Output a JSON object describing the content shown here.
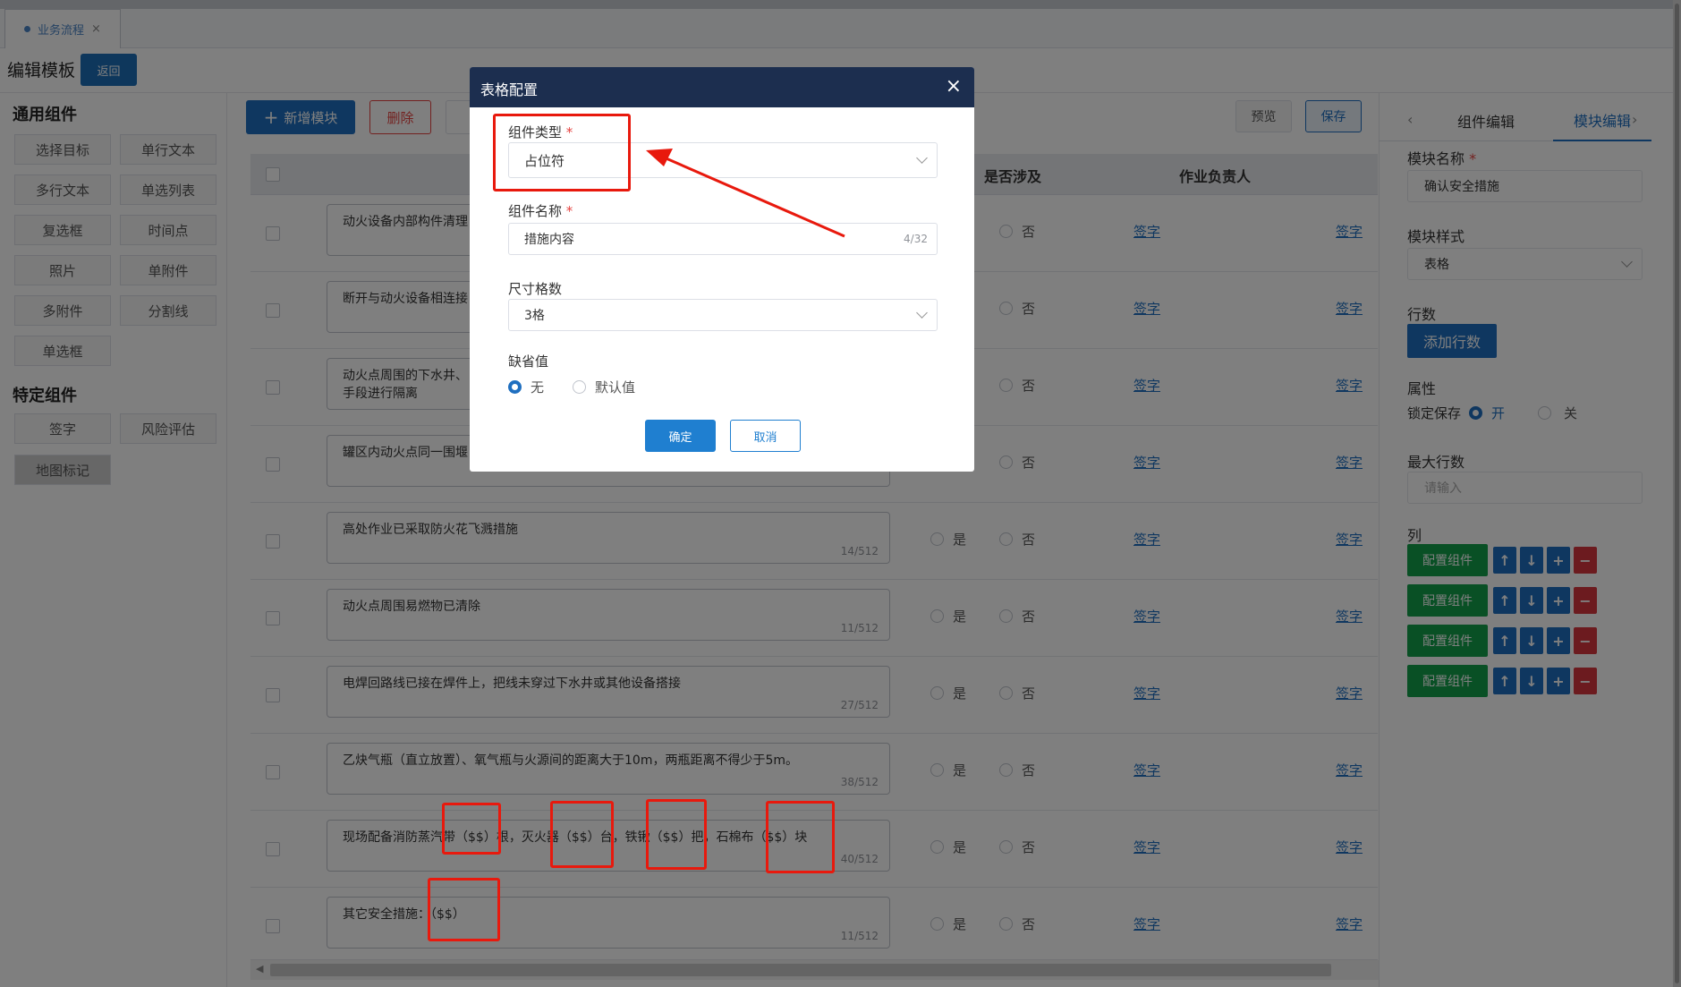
{
  "tabbar": {
    "tab_label": "业务流程",
    "tab_close": "×"
  },
  "header": {
    "title": "编辑模板",
    "back": "返回"
  },
  "left": {
    "general_title": "通用组件",
    "general": [
      "选择目标",
      "单行文本",
      "多行文本",
      "单选列表",
      "复选框",
      "时间点",
      "照片",
      "单附件",
      "多附件",
      "分割线",
      "单选框"
    ],
    "special_title": "特定组件",
    "special": [
      "签字",
      "风险评估",
      "地图标记"
    ]
  },
  "toolbar": {
    "add": "新增模块",
    "add_icon": "plus-icon",
    "delete": "删除",
    "preview": "预览",
    "save": "保存"
  },
  "table": {
    "headers": {
      "involved": "是否涉及",
      "responsible": "作业负责人"
    },
    "yes": "是",
    "no": "否",
    "sign": "签字",
    "rows": [
      {
        "text": "动火设备内部构件清理",
        "count": ""
      },
      {
        "text": "断开与动火设备相连接",
        "count": ""
      },
      {
        "text": "动火点周围的下水井、",
        "text2": "手段进行隔离",
        "count": ""
      },
      {
        "text": "罐区内动火点同一围堰",
        "count": ""
      },
      {
        "text": "高处作业已采取防火花飞溅措施",
        "count": "14/512"
      },
      {
        "text": "动火点周围易燃物已清除",
        "count": "11/512"
      },
      {
        "text": "电焊回路线已接在焊件上，把线未穿过下水井或其他设备搭接",
        "count": "27/512"
      },
      {
        "text": "乙炔气瓶（直立放置）、氧气瓶与火源间的距离大于10m，两瓶距离不得少于5m。",
        "count": "38/512"
      },
      {
        "text": "现场配备消防蒸汽带（$$）根，灭火器（$$）台，铁锹（$$）把，石棉布（$$）块",
        "count": "40/512"
      },
      {
        "text": "其它安全措施：（$$）",
        "count": "11/512"
      }
    ]
  },
  "right": {
    "tab_component": "组件编辑",
    "tab_module": "模块编辑",
    "module_name_label": "模块名称",
    "module_name": "确认安全措施",
    "module_style_label": "模块样式",
    "module_style": "表格",
    "rows_label": "行数",
    "add_rows": "添加行数",
    "attr_label": "属性",
    "lock_label": "锁定保存",
    "on": "开",
    "off": "关",
    "max_rows_label": "最大行数",
    "max_rows_placeholder": "请输入",
    "cols_label": "列",
    "config_btn": "配置组件",
    "up_icon": "↑",
    "down_icon": "↓",
    "plus_icon": "+",
    "minus_icon": "−"
  },
  "modal": {
    "title": "表格配置",
    "close": "×",
    "type_label": "组件类型",
    "type_value": "占位符",
    "name_label": "组件名称",
    "name_value": "措施内容",
    "name_count": "4/32",
    "size_label": "尺寸格数",
    "size_value": "3格",
    "default_label": "缺省值",
    "opt_none": "无",
    "opt_default": "默认值",
    "ok": "确定",
    "cancel": "取消"
  },
  "colors": {
    "accent": "#1f6fc0",
    "annotation": "#e8190d",
    "modal_header": "#1c2e4f",
    "config_green": "#13a04b",
    "danger": "#d9363e"
  }
}
